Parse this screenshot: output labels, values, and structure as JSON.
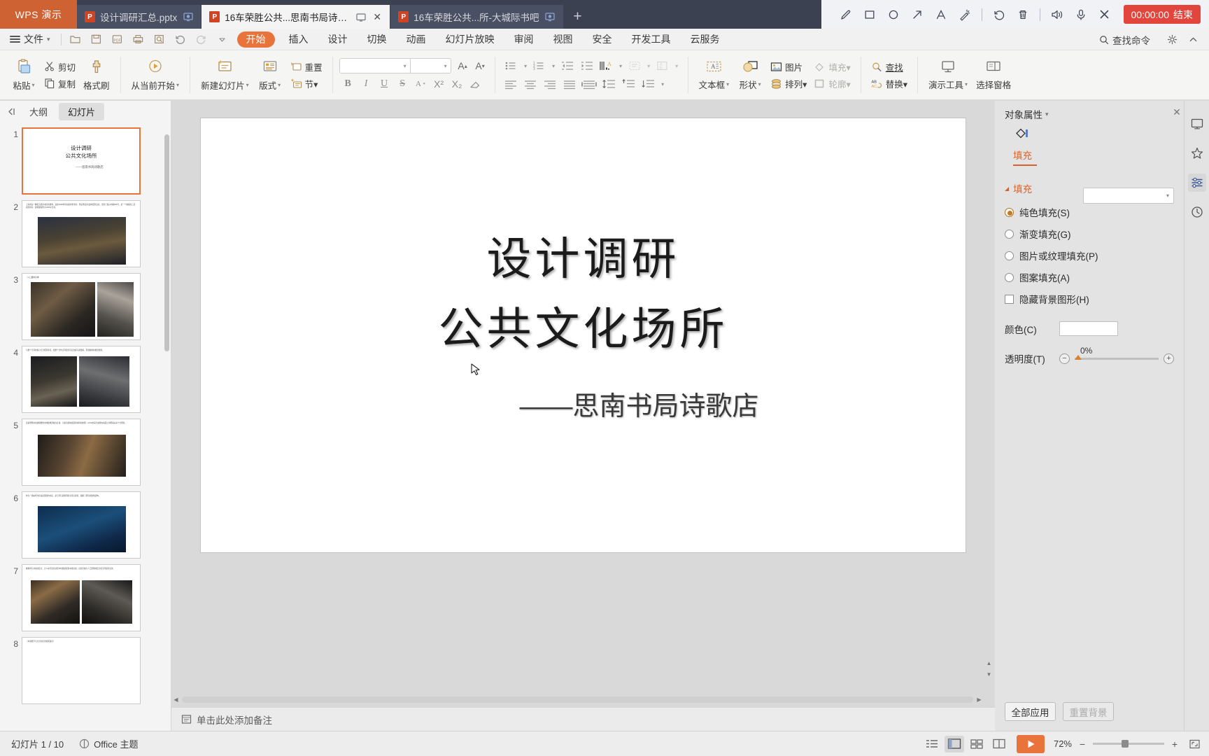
{
  "titlebar": {
    "brand": "WPS 演示",
    "tabs": [
      {
        "label": "设计调研汇总.pptx",
        "active": false,
        "has_close": false,
        "has_cast": true
      },
      {
        "label": "16车荣胜公共...思南书局诗歌店",
        "active": true,
        "has_close": true,
        "has_cast": true
      },
      {
        "label": "16车荣胜公共...所-大城际书吧",
        "active": false,
        "has_close": false,
        "has_cast": true
      }
    ],
    "new_tab_label": "+",
    "tools": [
      {
        "name": "pen-icon",
        "label": "画笔"
      },
      {
        "name": "rectangle-icon",
        "label": "矩形"
      },
      {
        "name": "ellipse-icon",
        "label": "椭圆"
      },
      {
        "name": "arrow-icon",
        "label": "箭头"
      },
      {
        "name": "text-icon",
        "label": "文字"
      },
      {
        "name": "magic-wand-icon",
        "label": "魔术笔"
      },
      {
        "name": "undo-icon",
        "label": "撤销"
      },
      {
        "name": "trash-icon",
        "label": "删除"
      },
      {
        "name": "speaker-icon",
        "label": "扬声器"
      },
      {
        "name": "microphone-icon",
        "label": "麦克风"
      },
      {
        "name": "close-icon",
        "label": "关闭"
      }
    ],
    "timer": "00:00:00",
    "end_label": "结束"
  },
  "menubar": {
    "file_label": "文件",
    "quick_icons": [
      "open-icon",
      "save-icon",
      "save-as-icon",
      "print-icon",
      "print-preview-icon",
      "undo-icon",
      "redo-icon",
      "customize-icon"
    ],
    "items": [
      {
        "label": "开始",
        "active": true
      },
      {
        "label": "插入",
        "active": false
      },
      {
        "label": "设计",
        "active": false
      },
      {
        "label": "切换",
        "active": false
      },
      {
        "label": "动画",
        "active": false
      },
      {
        "label": "幻灯片放映",
        "active": false
      },
      {
        "label": "审阅",
        "active": false
      },
      {
        "label": "视图",
        "active": false
      },
      {
        "label": "安全",
        "active": false
      },
      {
        "label": "开发工具",
        "active": false
      },
      {
        "label": "云服务",
        "active": false
      }
    ],
    "find_command": "查找命令",
    "right_icons": [
      "settings-icon",
      "collapse-ribbon-icon"
    ]
  },
  "ribbon": {
    "clipboard": {
      "paste": "粘贴",
      "cut": "剪切",
      "copy": "复制",
      "format_painter": "格式刷"
    },
    "present": {
      "from_current": "从当前开始"
    },
    "slides": {
      "new_slide": "新建幻灯片",
      "layout": "版式",
      "reset": "重置",
      "section": "节"
    },
    "font": {
      "font_name": "",
      "font_size": "",
      "grow_font": "A",
      "shrink_font": "A",
      "bold": "B",
      "italic": "I",
      "underline": "U",
      "strikethrough": "S",
      "font_color": "A",
      "superscript": "X²",
      "subscript": "X₂",
      "clear_format": "清除格式"
    },
    "paragraph": {
      "bullets": "项目符号",
      "numbering": "编号",
      "decrease_indent": "减少缩进",
      "increase_indent": "增加缩进",
      "text_direction": "文字方向",
      "align_text": "对齐文本",
      "convert_smartart": "转智能图形",
      "align_left": "左对齐",
      "align_center": "居中",
      "align_right": "右对齐",
      "justify": "两端对齐",
      "distribute": "分散对齐",
      "line_spacing": "行距",
      "para_spacing": "段落间距",
      "columns": "分栏"
    },
    "insert": {
      "textbox": "文本框",
      "shapes": "形状",
      "picture": "图片",
      "arrange": "排列",
      "fill": "填充",
      "outline": "轮廓"
    },
    "editing": {
      "find": "查找",
      "replace": "替换"
    },
    "tools": {
      "present_tools": "演示工具",
      "select_pane": "选择窗格"
    }
  },
  "sidebar": {
    "collapse_icon": "collapse-panel-icon",
    "tabs": [
      {
        "label": "大纲",
        "active": false
      },
      {
        "label": "幻灯片",
        "active": true
      }
    ],
    "slides": [
      {
        "number": "1",
        "selected": true,
        "kind": "title",
        "line1": "设计调研",
        "line2": "公共文化场所",
        "line3": "——思南书局诗歌店"
      },
      {
        "number": "2",
        "selected": false,
        "kind": "text-photo",
        "text": "上海南头一幢名为思南书局的建筑，这座1926年间兴建的老洋房，曾是著名的'爱神花园'旧址。坐落于复兴中路505号，是一个独栋的二层花园洋房，建筑面积约为1000平方米。"
      },
      {
        "number": "3",
        "selected": false,
        "kind": "two-photo",
        "text": "（入口楼梯主体）"
      },
      {
        "number": "4",
        "selected": false,
        "kind": "two-photo",
        "text": "与整个空间的核心灯光相互呼应，使整个室内空间更具有层次感与通透感，形成独特的视觉效果。"
      },
      {
        "number": "5",
        "selected": false,
        "kind": "one-photo",
        "text": "该案例所在的建筑整体主体建筑风格为红砖，为更直观地感受到材料的纹理，12:30的采光效果在墙面上的明暗关系十分明显。"
      },
      {
        "number": "6",
        "selected": false,
        "kind": "one-photo",
        "text": "作为一座由老洋房改造而成的书店，是空间与建筑间的对话与延续，保留了原有的建筑结构。"
      },
      {
        "number": "7",
        "selected": false,
        "kind": "two-photo",
        "text": "楼梯间与书架的结合，让人在行走的过程中也能感受到书香氛围，自然光线与人工照明的结合使空间更有层次。"
      },
      {
        "number": "8",
        "selected": false,
        "kind": "text-only",
        "text": "（书架细节与灯光的实景效果展示）"
      }
    ]
  },
  "slide": {
    "line1": "设计调研",
    "line2": "公共文化场所",
    "line3": "——思南书局诗歌店",
    "notes_placeholder": "单击此处添加备注",
    "notes_icon": "notes-icon"
  },
  "rpanel": {
    "title": "对象属性",
    "close_icon": "close-icon",
    "shape_icon": "shape-fill-icon",
    "tab_label": "填充",
    "section_label": "填充",
    "fill_select_value": "",
    "options": [
      {
        "label": "纯色填充(S)",
        "type": "radio",
        "checked": true
      },
      {
        "label": "渐变填充(G)",
        "type": "radio",
        "checked": false
      },
      {
        "label": "图片或纹理填充(P)",
        "type": "radio",
        "checked": false
      },
      {
        "label": "图案填充(A)",
        "type": "radio",
        "checked": false
      },
      {
        "label": "隐藏背景图形(H)",
        "type": "checkbox",
        "checked": false
      }
    ],
    "color_label": "颜色(C)",
    "color_value": "#ffffff",
    "transparency_label": "透明度(T)",
    "transparency_value": "0%",
    "apply_all": "全部应用",
    "reset_bg": "重置背景",
    "rail_icons": [
      "slide-design-icon",
      "animation-icon",
      "object-properties-icon",
      "history-icon"
    ]
  },
  "statusbar": {
    "slide_counter": "幻灯片 1 / 10",
    "theme": "Office 主题",
    "views": [
      {
        "name": "outline-view-icon",
        "active": false
      },
      {
        "name": "normal-view-icon",
        "active": true
      },
      {
        "name": "slide-sorter-icon",
        "active": false
      },
      {
        "name": "reading-view-icon",
        "active": false
      }
    ],
    "play_icon": "play-icon",
    "zoom_level": "72%",
    "zoom_out": "−",
    "zoom_in": "+",
    "fit_icon": "fit-to-window-icon"
  },
  "colors": {
    "brand_orange": "#e8743b",
    "title_bar": "#3c4152",
    "accent_red": "#e2453b",
    "panel_accent": "#d9622c"
  }
}
